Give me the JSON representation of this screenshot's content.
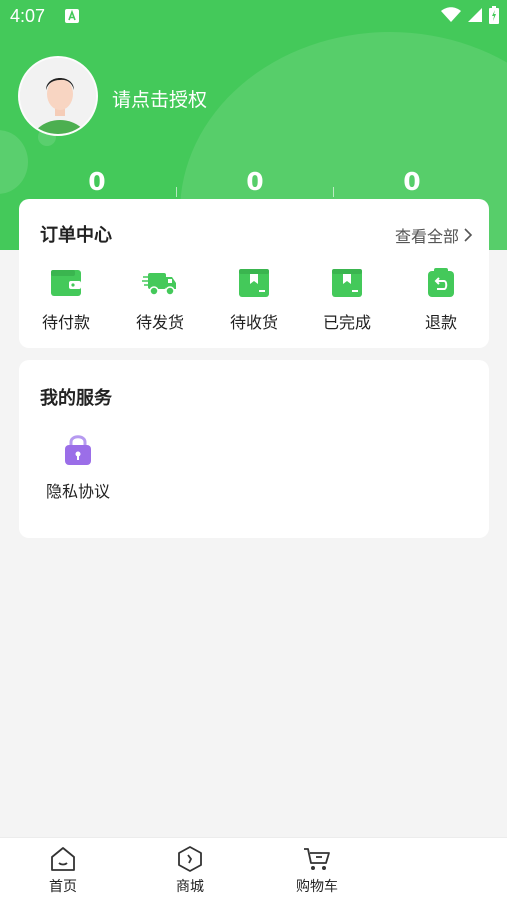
{
  "status_bar": {
    "time": "4:07"
  },
  "profile": {
    "auth_text": "请点击授权"
  },
  "stats": [
    {
      "value": "0"
    },
    {
      "value": "0"
    },
    {
      "value": "0"
    }
  ],
  "orders": {
    "title": "订单中心",
    "view_all": "查看全部",
    "items": [
      {
        "label": "待付款",
        "icon": "wallet-icon"
      },
      {
        "label": "待发货",
        "icon": "truck-icon"
      },
      {
        "label": "待收货",
        "icon": "package-icon"
      },
      {
        "label": "已完成",
        "icon": "box-check-icon"
      },
      {
        "label": "退款",
        "icon": "refund-icon"
      }
    ]
  },
  "services": {
    "title": "我的服务",
    "items": [
      {
        "label": "隐私协议",
        "icon": "lock-icon"
      }
    ]
  },
  "tabbar": {
    "tabs": [
      {
        "label": "首页",
        "icon": "home-icon"
      },
      {
        "label": "商城",
        "icon": "shop-icon"
      },
      {
        "label": "购物车",
        "icon": "cart-icon"
      }
    ]
  },
  "colors": {
    "primary": "#44c95a",
    "lock": "#9b6ee8"
  }
}
